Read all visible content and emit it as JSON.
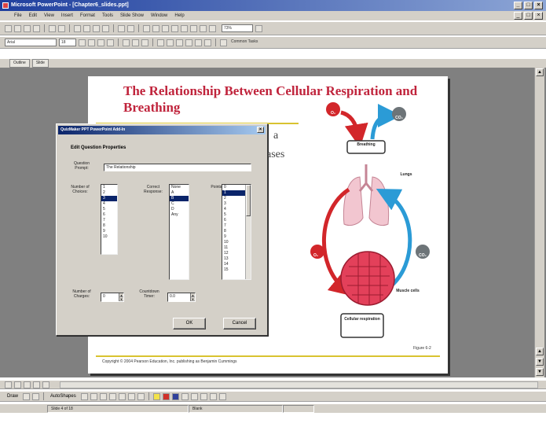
{
  "window": {
    "title": "Microsoft PowerPoint - [Chapter6_slides.ppt]",
    "minimize": "_",
    "maximize": "□",
    "close": "×"
  },
  "menu": [
    "File",
    "Edit",
    "View",
    "Insert",
    "Format",
    "Tools",
    "Slide Show",
    "Window",
    "Help"
  ],
  "toolbar": {
    "zoom": "73%",
    "font": "Arial",
    "font_size": "18",
    "common_tasks": "Common Tasks"
  },
  "tabs": [
    "Outline",
    "Slide"
  ],
  "slide": {
    "title": "The Relationship Between Cellular Respiration and Breathing",
    "bg_text_1": "a",
    "bg_text_2": "gases",
    "copyright": "Copyright © 2004 Pearson Education, Inc. publishing as Benjamin Cummings",
    "figure_label": "Figure 6-2",
    "diagram": {
      "breathing": "Breathing",
      "lungs": "Lungs",
      "muscle_cells": "Muscle cells",
      "cellular_respiration": "Cellular respiration",
      "o2": "O₂",
      "co2": "CO₂"
    }
  },
  "dialog": {
    "title": "QuizMaker PPT PowerPoint Add-In",
    "close": "×",
    "heading": "Edit Question Properties",
    "question_prompt_label": "Question Prompt:",
    "question_prompt_value": "The Relationship",
    "num_choices_label": "Number of Choices:",
    "num_choices_options": [
      "1",
      "2",
      "3",
      "4",
      "5",
      "6",
      "7",
      "8",
      "9",
      "10"
    ],
    "num_choices_selected": 2,
    "correct_response_label": "Correct Response:",
    "correct_response_options": [
      "None",
      "A",
      "B",
      "C",
      "D",
      "Any"
    ],
    "correct_response_selected": 2,
    "points_label": "Points:",
    "points_options": [
      "0",
      "1",
      "2",
      "3",
      "4",
      "5",
      "6",
      "7",
      "8",
      "9",
      "10",
      "11",
      "12",
      "13",
      "14",
      "15"
    ],
    "points_selected": 1,
    "num_charges_label": "Number of Charges:",
    "num_charges_value": "0",
    "countdown_label": "Countdown Timer:",
    "countdown_value": "0.0",
    "ok": "OK",
    "cancel": "Cancel"
  },
  "status": {
    "slide": "Slide 4 of 18",
    "design": "Blank"
  },
  "draw_toolbar": {
    "draw": "Draw",
    "autoshapes": "AutoShapes"
  }
}
